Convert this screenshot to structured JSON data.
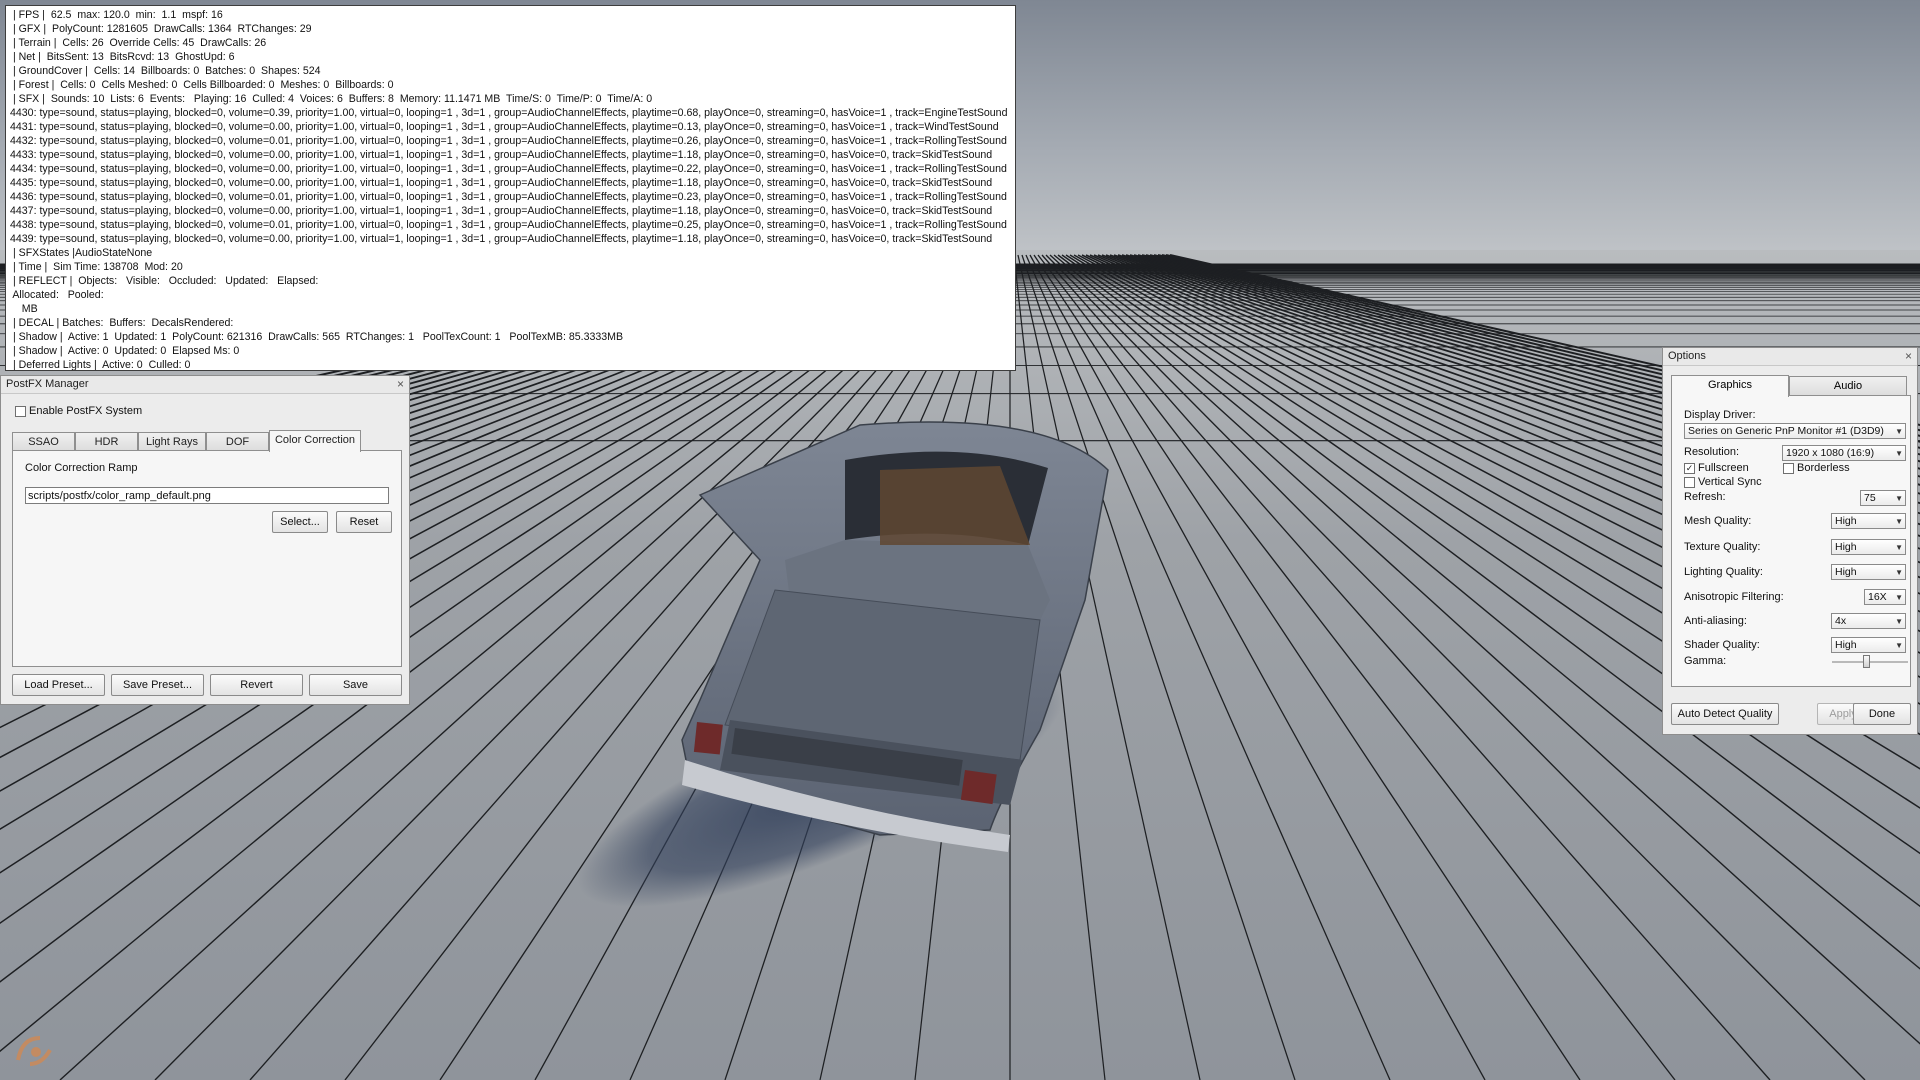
{
  "colors": {
    "window_bg": "#ececec",
    "console_bg": "#ffffff",
    "floor": "#8f949b",
    "sky": "#a5abb3"
  },
  "console": {
    "lines": [
      " | FPS |  62.5  max: 120.0  min:  1.1  mspf: 16",
      " | GFX |  PolyCount: 1281605  DrawCalls: 1364  RTChanges: 29",
      " | Terrain |  Cells: 26  Override Cells: 45  DrawCalls: 26",
      " | Net |  BitsSent: 13  BitsRcvd: 13  GhostUpd: 6",
      " | GroundCover |  Cells: 14  Billboards: 0  Batches: 0  Shapes: 524",
      " | Forest |  Cells: 0  Cells Meshed: 0  Cells Billboarded: 0  Meshes: 0  Billboards: 0",
      " | SFX |  Sounds: 10  Lists: 6  Events:   Playing: 16  Culled: 4  Voices: 6  Buffers: 8  Memory: 11.1471 MB  Time/S: 0  Time/P: 0  Time/A: 0",
      "4430: type=sound, status=playing, blocked=0, volume=0.39, priority=1.00, virtual=0, looping=1 , 3d=1 , group=AudioChannelEffects, playtime=0.68, playOnce=0, streaming=0, hasVoice=1 , track=EngineTestSound",
      "4431: type=sound, status=playing, blocked=0, volume=0.00, priority=1.00, virtual=0, looping=1 , 3d=1 , group=AudioChannelEffects, playtime=0.13, playOnce=0, streaming=0, hasVoice=1 , track=WindTestSound",
      "4432: type=sound, status=playing, blocked=0, volume=0.01, priority=1.00, virtual=0, looping=1 , 3d=1 , group=AudioChannelEffects, playtime=0.26, playOnce=0, streaming=0, hasVoice=1 , track=RollingTestSound",
      "4433: type=sound, status=playing, blocked=0, volume=0.00, priority=1.00, virtual=1, looping=1 , 3d=1 , group=AudioChannelEffects, playtime=1.18, playOnce=0, streaming=0, hasVoice=0, track=SkidTestSound",
      "4434: type=sound, status=playing, blocked=0, volume=0.00, priority=1.00, virtual=0, looping=1 , 3d=1 , group=AudioChannelEffects, playtime=0.22, playOnce=0, streaming=0, hasVoice=1 , track=RollingTestSound",
      "4435: type=sound, status=playing, blocked=0, volume=0.00, priority=1.00, virtual=1, looping=1 , 3d=1 , group=AudioChannelEffects, playtime=1.18, playOnce=0, streaming=0, hasVoice=0, track=SkidTestSound",
      "4436: type=sound, status=playing, blocked=0, volume=0.01, priority=1.00, virtual=0, looping=1 , 3d=1 , group=AudioChannelEffects, playtime=0.23, playOnce=0, streaming=0, hasVoice=1 , track=RollingTestSound",
      "4437: type=sound, status=playing, blocked=0, volume=0.00, priority=1.00, virtual=1, looping=1 , 3d=1 , group=AudioChannelEffects, playtime=1.18, playOnce=0, streaming=0, hasVoice=0, track=SkidTestSound",
      "4438: type=sound, status=playing, blocked=0, volume=0.01, priority=1.00, virtual=0, looping=1 , 3d=1 , group=AudioChannelEffects, playtime=0.25, playOnce=0, streaming=0, hasVoice=1 , track=RollingTestSound",
      "4439: type=sound, status=playing, blocked=0, volume=0.00, priority=1.00, virtual=1, looping=1 , 3d=1 , group=AudioChannelEffects, playtime=1.18, playOnce=0, streaming=0, hasVoice=0, track=SkidTestSound",
      " | SFXStates |AudioStateNone",
      " | Time |  Sim Time: 138708  Mod: 20",
      " | REFLECT |  Objects:   Visible:   Occluded:   Updated:   Elapsed:",
      " Allocated:   Pooled:",
      "    MB",
      " | DECAL | Batches:  Buffers:  DecalsRendered:",
      " | Shadow |  Active: 1  Updated: 1  PolyCount: 621316  DrawCalls: 565  RTChanges: 1   PoolTexCount: 1   PoolTexMB: 85.3333MB",
      " | Shadow |  Active: 0  Updated: 0  Elapsed Ms: 0",
      " | Deferred Lights |  Active: 0  Culled: 0"
    ]
  },
  "postfx": {
    "title": "PostFX Manager",
    "enable_label": "Enable PostFX System",
    "enable_checked": false,
    "tabs": [
      "SSAO",
      "HDR",
      "Light Rays",
      "DOF",
      "Color Correction"
    ],
    "active_tab": "Color Correction",
    "ramp_label": "Color Correction Ramp",
    "ramp_value": "scripts/postfx/color_ramp_default.png",
    "select_label": "Select...",
    "reset_label": "Reset",
    "load_label": "Load Preset...",
    "save_preset_label": "Save Preset...",
    "revert_label": "Revert",
    "save_label": "Save"
  },
  "options": {
    "title": "Options",
    "tabs": [
      "Graphics",
      "Audio"
    ],
    "active_tab": "Graphics",
    "display_driver_label": "Display Driver:",
    "display_driver_value": "Series on Generic PnP Monitor #1 (D3D9)",
    "resolution_label": "Resolution:",
    "resolution_value": "1920 x 1080 (16:9)",
    "fullscreen_label": "Fullscreen",
    "fullscreen_checked": true,
    "borderless_label": "Borderless",
    "borderless_checked": false,
    "vsync_label": "Vertical Sync",
    "vsync_checked": false,
    "refresh_label": "Refresh:",
    "refresh_value": "75",
    "mesh_label": "Mesh Quality:",
    "mesh_value": "High",
    "texture_label": "Texture Quality:",
    "texture_value": "High",
    "lighting_label": "Lighting Quality:",
    "lighting_value": "High",
    "aniso_label": "Anisotropic Filtering:",
    "aniso_value": "16X",
    "aa_label": "Anti-aliasing:",
    "aa_value": "4x",
    "shader_label": "Shader Quality:",
    "shader_value": "High",
    "gamma_label": "Gamma:",
    "gamma_level": 0.45,
    "auto_detect_label": "Auto Detect Quality",
    "apply_label": "Apply",
    "done_label": "Done"
  },
  "icons": {
    "close": "close-icon",
    "logo": "engine-logo-icon",
    "dropdown": "chevron-down-icon"
  },
  "glyphs": {
    "close": "×",
    "check": "✓",
    "arrow": "▼"
  }
}
